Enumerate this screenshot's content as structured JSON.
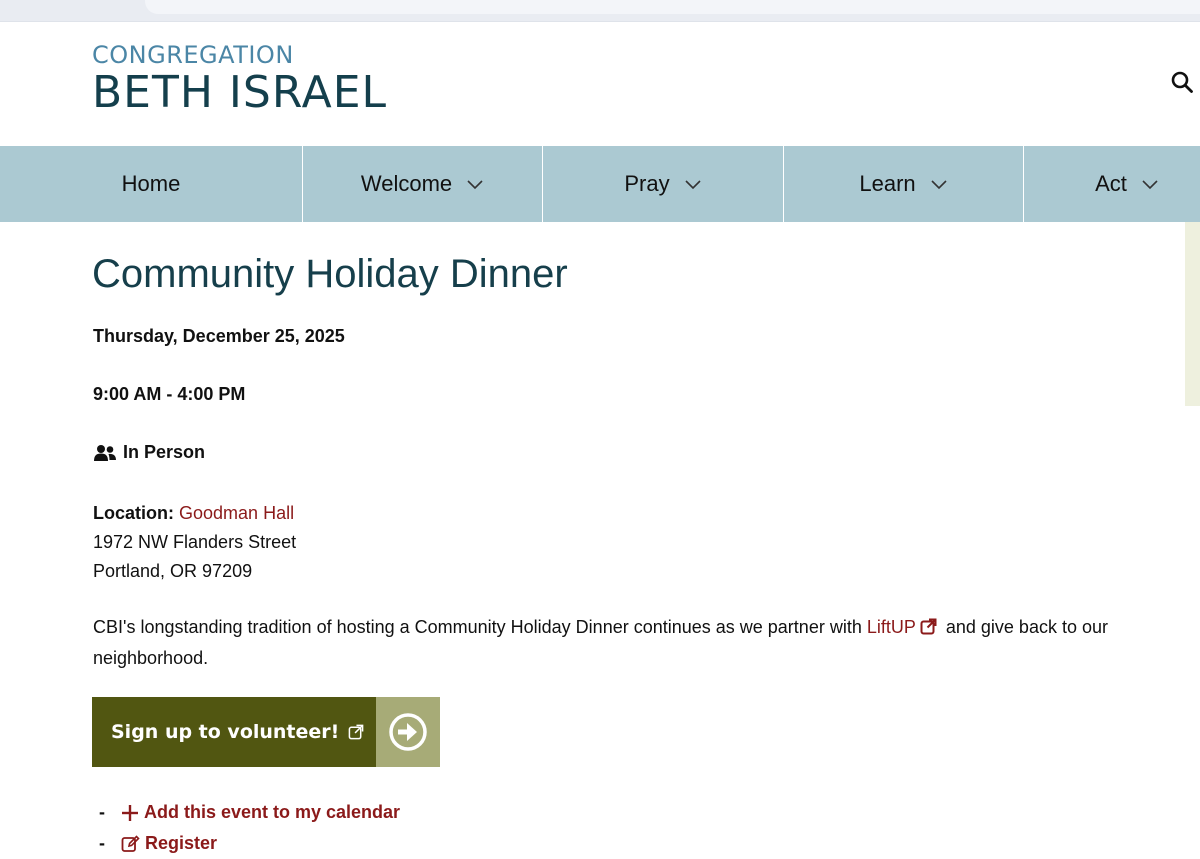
{
  "site": {
    "logo_line1": "CONGREGATION",
    "logo_line2": "BETH ISRAEL",
    "search_icon": "search-icon"
  },
  "nav": {
    "items": [
      {
        "label": "Home",
        "has_dropdown": false
      },
      {
        "label": "Welcome",
        "has_dropdown": true
      },
      {
        "label": "Pray",
        "has_dropdown": true
      },
      {
        "label": "Learn",
        "has_dropdown": true
      },
      {
        "label": "Act",
        "has_dropdown": true
      }
    ]
  },
  "event": {
    "title": "Community Holiday Dinner",
    "date": "Thursday, December 25, 2025",
    "time": "9:00 AM - 4:00 PM",
    "mode": "In Person",
    "location_label": "Location:",
    "location_name": "Goodman Hall",
    "address_line1": "1972 NW Flanders Street",
    "address_line2": "Portland, OR 97209",
    "description_before": "CBI's longstanding tradition of hosting a Community Holiday Dinner continues as we partner with ",
    "description_link": "LiftUP",
    "description_after": " and give back to our neighborhood.",
    "cta_label": "Sign up to volunteer!",
    "add_calendar_label": "Add this event to my calendar",
    "register_label": "Register"
  },
  "colors": {
    "nav_bg": "#abc9d2",
    "title": "#163f4b",
    "logo_small": "#4b86a6",
    "link": "#8b1a1a",
    "cta_bg": "#515611",
    "cta_arrow_bg": "#a7ab77"
  }
}
